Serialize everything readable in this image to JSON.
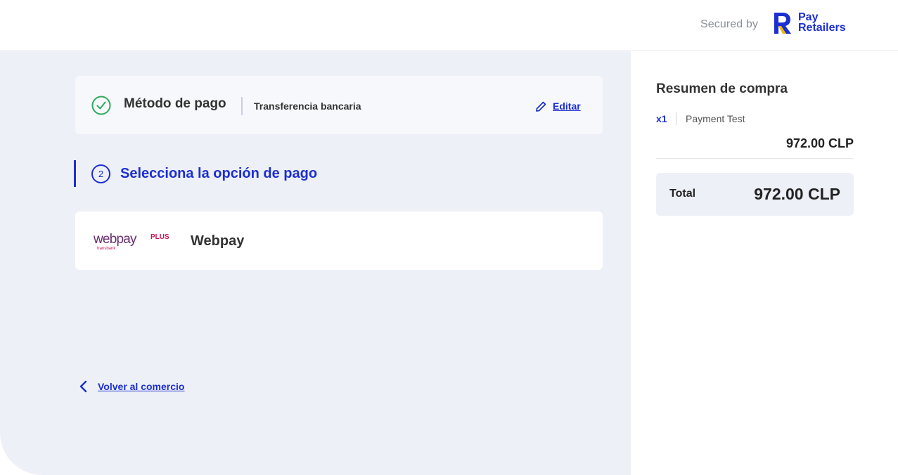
{
  "header": {
    "secured_label": "Secured by",
    "brand": {
      "line1": "Pay",
      "line2": "Retailers",
      "color": "#1c2fd1",
      "accent": "#f2b705"
    }
  },
  "payment_method": {
    "title": "Método de pago",
    "value": "Transferencia bancaria",
    "edit_label": "Editar",
    "status_color": "#2eaa5c"
  },
  "step": {
    "number": "2",
    "title": "Selecciona la opción de pago"
  },
  "options": [
    {
      "logo_text": "webpay",
      "logo_plus": "PLUS",
      "logo_sub": "transbank",
      "label": "Webpay"
    }
  ],
  "back_link": {
    "label": "Volver al comercio"
  },
  "summary": {
    "title": "Resumen de compra",
    "item": {
      "qty": "x1",
      "name": "Payment Test",
      "price": "972.00 CLP"
    },
    "total_label": "Total",
    "total_value": "972.00 CLP"
  },
  "colors": {
    "accent": "#1c2fd1",
    "background": "#eef0f7",
    "success": "#2eaa5c"
  }
}
